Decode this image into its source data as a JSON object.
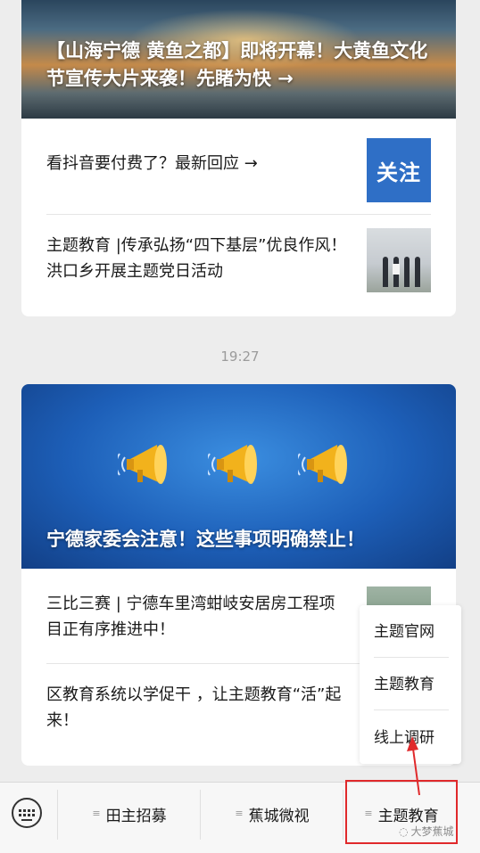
{
  "feed": {
    "card1": {
      "hero_title": "【山海宁德 黄鱼之都】即将开幕！大黄鱼文化节宣传大片来袭！先睹为快 →",
      "items": [
        {
          "title": "看抖音要付费了？最新回应 →",
          "thumb_text": "关注"
        },
        {
          "title": "主题教育 |传承弘扬“四下基层”优良作风！洪口乡开展主题党日活动"
        }
      ]
    },
    "timestamp": "19:27",
    "card2": {
      "hero_title": "宁德家委会注意！这些事项明确禁止！",
      "items": [
        {
          "title": "三比三赛 | 宁德车里湾蚶岐安居房工程项目正有序推进中！"
        },
        {
          "title": "区教育系统以学促干 ，让主题教育“活”起来！"
        }
      ]
    }
  },
  "submenu": {
    "items": [
      "主题官网",
      "主题教育",
      "线上调研"
    ]
  },
  "bottom_menu": {
    "keyboard_icon": "keyboard-icon",
    "buttons": [
      "田主招募",
      "蕉城微视",
      "主题教育"
    ]
  },
  "watermark": "大梦蕉城",
  "colors": {
    "highlight": "#e0292b",
    "follow_thumb": "#2f6fc6",
    "speaker": "#f2b21c"
  }
}
